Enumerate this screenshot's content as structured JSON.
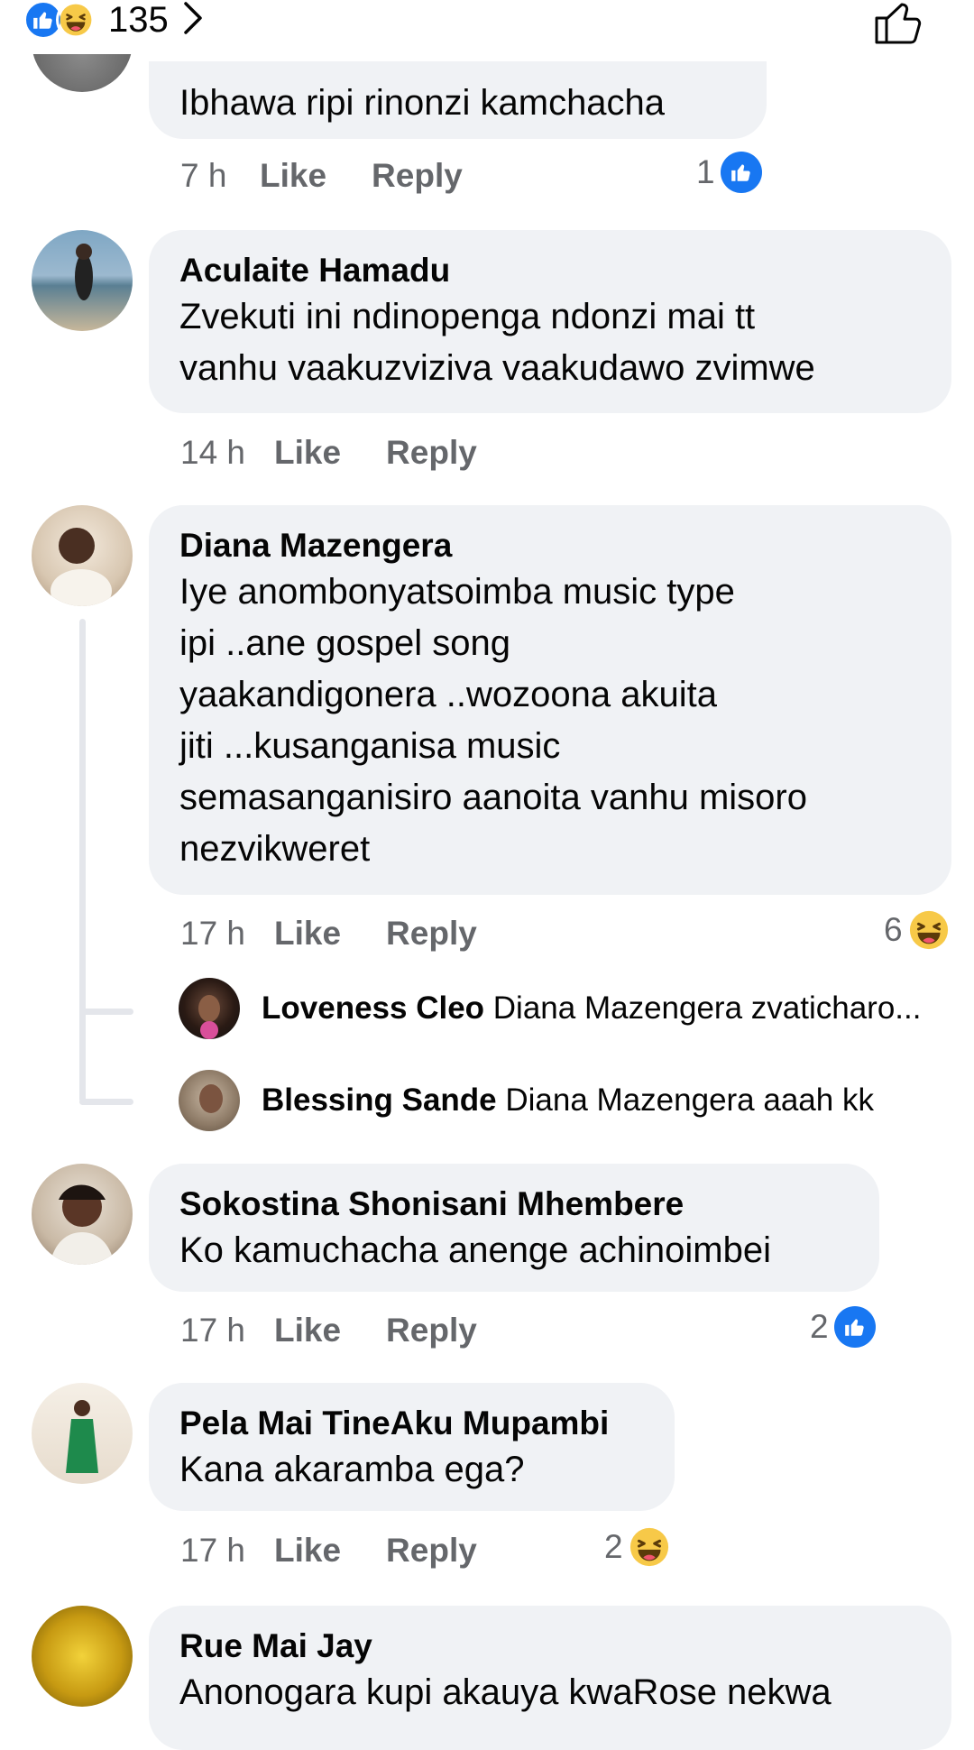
{
  "header": {
    "reaction_count": "135",
    "reactions": [
      "like-icon",
      "haha-icon"
    ]
  },
  "comments": [
    {
      "author": "",
      "text": "Ibhawa ripi rinonzi kamchacha",
      "time": "7 h",
      "like": "Like",
      "reply": "Reply",
      "reaction_count": "1",
      "reaction": "like-icon"
    },
    {
      "author": "Aculaite Hamadu",
      "text": "Zvekuti ini ndinopenga ndonzi mai tt\nvanhu vaakuzviziva vaakudawo zvimwe",
      "time": "14 h",
      "like": "Like",
      "reply": "Reply"
    },
    {
      "author": "Diana Mazengera",
      "text": "Iye anombonyatsoimba music type\nipi ..ane gospel song\nyaakandigonera ..wozoona akuita\njiti ...kusanganisa music\nsemasanganisiro aanoita vanhu misoro\nnezvikweret",
      "time": "17 h",
      "like": "Like",
      "reply": "Reply",
      "reaction_count": "6",
      "reaction": "haha-icon"
    },
    {
      "author": "Sokostina Shonisani Mhembere",
      "text": "Ko kamuchacha anenge achinoimbei",
      "time": "17 h",
      "like": "Like",
      "reply": "Reply",
      "reaction_count": "2",
      "reaction": "like-icon"
    },
    {
      "author": "Pela Mai TineAku Mupambi",
      "text": "Kana akaramba ega?",
      "time": "17 h",
      "like": "Like",
      "reply": "Reply",
      "reaction_count": "2",
      "reaction": "haha-icon"
    },
    {
      "author": "Rue Mai Jay",
      "text": "Anonogara kupi akauya kwaRose nekwa"
    }
  ],
  "replies": [
    {
      "author": "Loveness Cleo",
      "text": "Diana Mazengera zvaticharo..."
    },
    {
      "author": "Blessing Sande",
      "text": "Diana Mazengera aaah kk"
    }
  ],
  "colors": {
    "like_blue": "#1877f2",
    "haha_yellow": "#f7c948",
    "bubble_bg": "#f0f2f5",
    "meta_gray": "#65676b",
    "thread_line": "#e4e6eb"
  }
}
